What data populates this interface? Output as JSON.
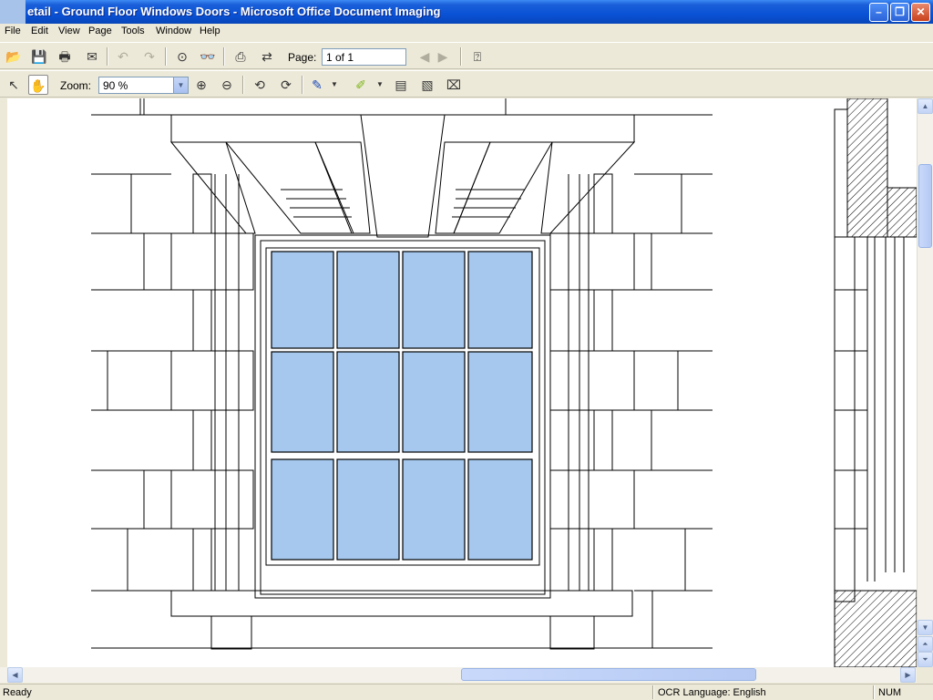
{
  "window": {
    "title": "etail - Ground Floor Windows Doors - Microsoft Office Document Imaging",
    "minimize": "–",
    "restore": "❐",
    "close": "✕"
  },
  "menu": {
    "items": [
      {
        "id": "file",
        "label": "File"
      },
      {
        "id": "edit",
        "label": "Edit"
      },
      {
        "id": "view",
        "label": "View"
      },
      {
        "id": "page",
        "label": "Page"
      },
      {
        "id": "tools",
        "label": "Tools"
      },
      {
        "id": "window",
        "label": "Window"
      },
      {
        "id": "help",
        "label": "Help"
      }
    ]
  },
  "toolbar1": {
    "open_icon": "folder-open-icon",
    "save_icon": "save-icon",
    "print_icon": "print-icon",
    "send_icon": "send-icon",
    "undo_icon": "undo-icon",
    "redo_icon": "redo-icon",
    "ocr_icon": "ocr-icon",
    "find_icon": "binoculars-icon",
    "page_label": "Page:",
    "page_value": "1 of 1",
    "help_icon": "help-icon"
  },
  "toolbar2": {
    "zoom_label": "Zoom:",
    "zoom_value": "90 %",
    "zoom_in_icon": "zoom-in-icon",
    "zoom_out_icon": "zoom-out-icon"
  },
  "status": {
    "ready": "Ready",
    "ocr_language": "OCR Language: English",
    "num": "NUM"
  }
}
